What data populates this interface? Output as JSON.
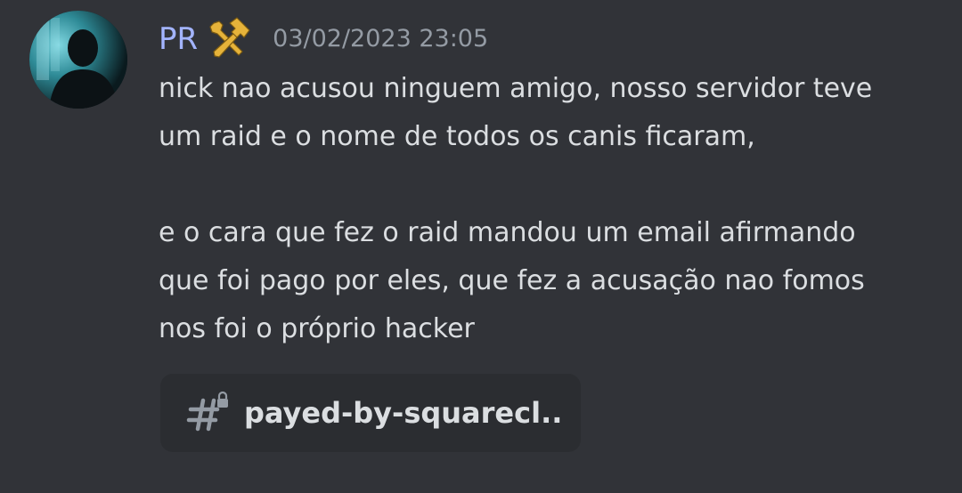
{
  "message": {
    "author": {
      "name": "PR",
      "name_color": "#a3b4ff",
      "avatar": "silhouette-avatar",
      "role_icon": "hammer-wrench-icon"
    },
    "timestamp": "03/02/2023 23:05",
    "lines": [
      "nick nao acusou ninguem amigo, nosso servidor teve",
      "um raid e o nome de todos os canis ficaram,",
      "",
      "e o cara que fez o raid mandou um email afirmando",
      "que foi pago por eles, que fez a acusação nao fomos",
      "nos foi o próprio hacker"
    ],
    "channel_mention": {
      "icon": "locked-hashtag-icon",
      "name": "payed-by-squarecl.."
    }
  },
  "colors": {
    "background": "#313338",
    "chip_background": "#2b2d31",
    "text": "#dbdee1",
    "muted": "#949ba4",
    "role_icon": "#e6b33a"
  }
}
